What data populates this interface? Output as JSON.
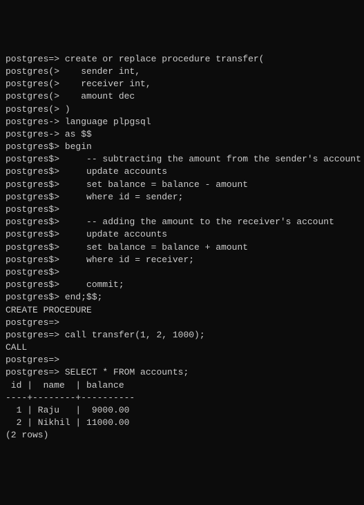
{
  "lines": [
    {
      "prompt": "postgres=> ",
      "text": "create or replace procedure transfer("
    },
    {
      "prompt": "postgres(>    ",
      "text": "sender int,"
    },
    {
      "prompt": "postgres(>    ",
      "text": "receiver int,"
    },
    {
      "prompt": "postgres(>    ",
      "text": "amount dec"
    },
    {
      "prompt": "postgres(> ",
      "text": ")"
    },
    {
      "prompt": "postgres-> ",
      "text": "language plpgsql"
    },
    {
      "prompt": "postgres-> ",
      "text": "as $$"
    },
    {
      "prompt": "postgres$> ",
      "text": "begin"
    },
    {
      "prompt": "postgres$>     ",
      "text": "-- subtracting the amount from the sender's account"
    },
    {
      "prompt": "postgres$>     ",
      "text": "update accounts"
    },
    {
      "prompt": "postgres$>     ",
      "text": "set balance = balance - amount"
    },
    {
      "prompt": "postgres$>     ",
      "text": "where id = sender;"
    },
    {
      "prompt": "postgres$>",
      "text": ""
    },
    {
      "prompt": "postgres$>     ",
      "text": "-- adding the amount to the receiver's account"
    },
    {
      "prompt": "postgres$>     ",
      "text": "update accounts"
    },
    {
      "prompt": "postgres$>     ",
      "text": "set balance = balance + amount"
    },
    {
      "prompt": "postgres$>     ",
      "text": "where id = receiver;"
    },
    {
      "prompt": "postgres$>",
      "text": ""
    },
    {
      "prompt": "postgres$>     ",
      "text": "commit;"
    },
    {
      "prompt": "postgres$> ",
      "text": "end;$$;"
    },
    {
      "prompt": "",
      "text": "CREATE PROCEDURE"
    },
    {
      "prompt": "postgres=>",
      "text": ""
    },
    {
      "prompt": "postgres=> ",
      "text": "call transfer(1, 2, 1000);"
    },
    {
      "prompt": "",
      "text": "CALL"
    },
    {
      "prompt": "postgres=>",
      "text": ""
    },
    {
      "prompt": "postgres=> ",
      "text": "SELECT * FROM accounts;"
    },
    {
      "prompt": "",
      "text": " id |  name  | balance"
    },
    {
      "prompt": "",
      "text": "----+--------+----------"
    },
    {
      "prompt": "",
      "text": "  1 | Raju   |  9000.00"
    },
    {
      "prompt": "",
      "text": "  2 | Nikhil | 11000.00"
    },
    {
      "prompt": "",
      "text": "(2 rows)"
    }
  ]
}
